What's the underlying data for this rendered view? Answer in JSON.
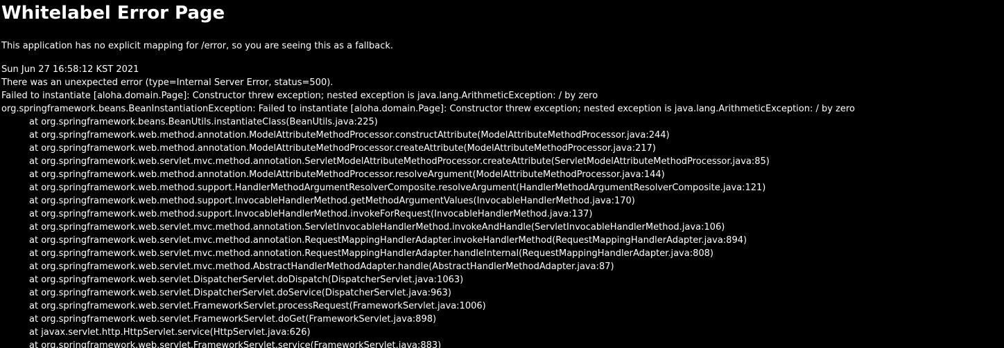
{
  "page": {
    "title": "Whitelabel Error Page",
    "explanation": "This application has no explicit mapping for /error, so you are seeing this as a fallback.",
    "timestamp": "Sun Jun 27 16:58:12 KST 2021",
    "error_summary": "There was an unexpected error (type=Internal Server Error, status=500).",
    "message": "Failed to instantiate [aloha.domain.Page]: Constructor threw exception; nested exception is java.lang.ArithmeticException: / by zero",
    "exception": "org.springframework.beans.BeanInstantiationException: Failed to instantiate [aloha.domain.Page]: Constructor threw exception; nested exception is java.lang.ArithmeticException: / by zero",
    "stack": [
      "at org.springframework.beans.BeanUtils.instantiateClass(BeanUtils.java:225)",
      "at org.springframework.web.method.annotation.ModelAttributeMethodProcessor.constructAttribute(ModelAttributeMethodProcessor.java:244)",
      "at org.springframework.web.method.annotation.ModelAttributeMethodProcessor.createAttribute(ModelAttributeMethodProcessor.java:217)",
      "at org.springframework.web.servlet.mvc.method.annotation.ServletModelAttributeMethodProcessor.createAttribute(ServletModelAttributeMethodProcessor.java:85)",
      "at org.springframework.web.method.annotation.ModelAttributeMethodProcessor.resolveArgument(ModelAttributeMethodProcessor.java:144)",
      "at org.springframework.web.method.support.HandlerMethodArgumentResolverComposite.resolveArgument(HandlerMethodArgumentResolverComposite.java:121)",
      "at org.springframework.web.method.support.InvocableHandlerMethod.getMethodArgumentValues(InvocableHandlerMethod.java:170)",
      "at org.springframework.web.method.support.InvocableHandlerMethod.invokeForRequest(InvocableHandlerMethod.java:137)",
      "at org.springframework.web.servlet.mvc.method.annotation.ServletInvocableHandlerMethod.invokeAndHandle(ServletInvocableHandlerMethod.java:106)",
      "at org.springframework.web.servlet.mvc.method.annotation.RequestMappingHandlerAdapter.invokeHandlerMethod(RequestMappingHandlerAdapter.java:894)",
      "at org.springframework.web.servlet.mvc.method.annotation.RequestMappingHandlerAdapter.handleInternal(RequestMappingHandlerAdapter.java:808)",
      "at org.springframework.web.servlet.mvc.method.AbstractHandlerMethodAdapter.handle(AbstractHandlerMethodAdapter.java:87)",
      "at org.springframework.web.servlet.DispatcherServlet.doDispatch(DispatcherServlet.java:1063)",
      "at org.springframework.web.servlet.DispatcherServlet.doService(DispatcherServlet.java:963)",
      "at org.springframework.web.servlet.FrameworkServlet.processRequest(FrameworkServlet.java:1006)",
      "at org.springframework.web.servlet.FrameworkServlet.doGet(FrameworkServlet.java:898)",
      "at javax.servlet.http.HttpServlet.service(HttpServlet.java:626)",
      "at org.springframework.web.servlet.FrameworkServlet.service(FrameworkServlet.java:883)"
    ]
  },
  "colors": {
    "background": "#000000",
    "text": "#ffffff"
  }
}
